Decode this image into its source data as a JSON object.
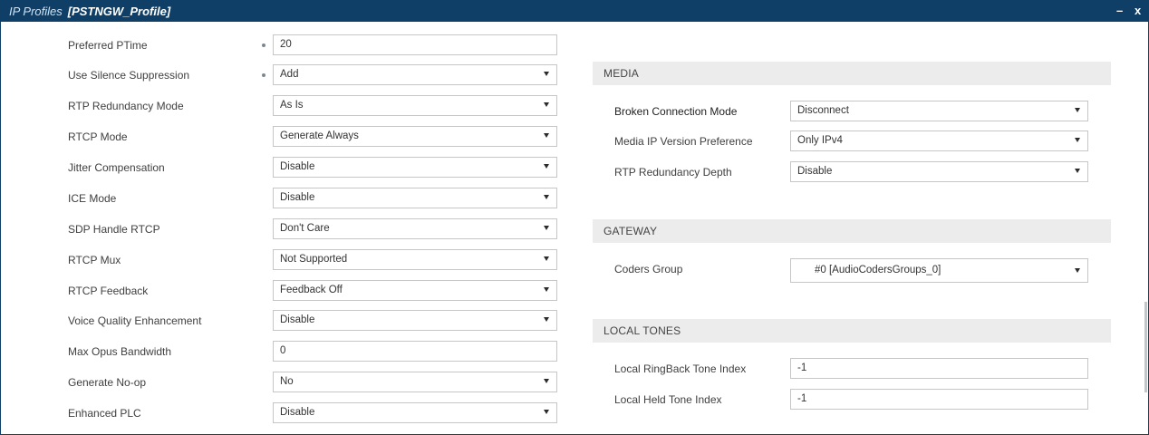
{
  "window": {
    "title_prefix": "IP Profiles",
    "title_name": "[PSTNGW_Profile]",
    "minimize": "–",
    "close": "x"
  },
  "left": {
    "fields": [
      {
        "label": "Preferred PTime",
        "value": "20",
        "type": "input",
        "modified": true
      },
      {
        "label": "Use Silence Suppression",
        "value": "Add",
        "type": "select",
        "modified": true
      },
      {
        "label": "RTP Redundancy Mode",
        "value": "As Is",
        "type": "select"
      },
      {
        "label": "RTCP Mode",
        "value": "Generate Always",
        "type": "select"
      },
      {
        "label": "Jitter Compensation",
        "value": "Disable",
        "type": "select"
      },
      {
        "label": "ICE Mode",
        "value": "Disable",
        "type": "select"
      },
      {
        "label": "SDP Handle RTCP",
        "value": "Don't Care",
        "type": "select"
      },
      {
        "label": "RTCP Mux",
        "value": "Not Supported",
        "type": "select"
      },
      {
        "label": "RTCP Feedback",
        "value": "Feedback Off",
        "type": "select"
      },
      {
        "label": "Voice Quality Enhancement",
        "value": "Disable",
        "type": "select"
      },
      {
        "label": "Max Opus Bandwidth",
        "value": "0",
        "type": "input"
      },
      {
        "label": "Generate No-op",
        "value": "No",
        "type": "select"
      },
      {
        "label": "Enhanced PLC",
        "value": "Disable",
        "type": "select"
      }
    ]
  },
  "media": {
    "header": "MEDIA",
    "fields": [
      {
        "label": "Broken Connection Mode",
        "value": "Disconnect",
        "type": "select"
      },
      {
        "label": "Media IP Version Preference",
        "value": "Only IPv4",
        "type": "select"
      },
      {
        "label": "RTP Redundancy Depth",
        "value": "Disable",
        "type": "select"
      }
    ]
  },
  "gateway": {
    "header": "GATEWAY",
    "fields": [
      {
        "label": "Coders Group",
        "value": "#0 [AudioCodersGroups_0]",
        "type": "select"
      }
    ]
  },
  "local_tones": {
    "header": "LOCAL TONES",
    "fields": [
      {
        "label": "Local RingBack Tone Index",
        "value": "-1",
        "type": "input"
      },
      {
        "label": "Local Held Tone Index",
        "value": "-1",
        "type": "input"
      }
    ]
  }
}
